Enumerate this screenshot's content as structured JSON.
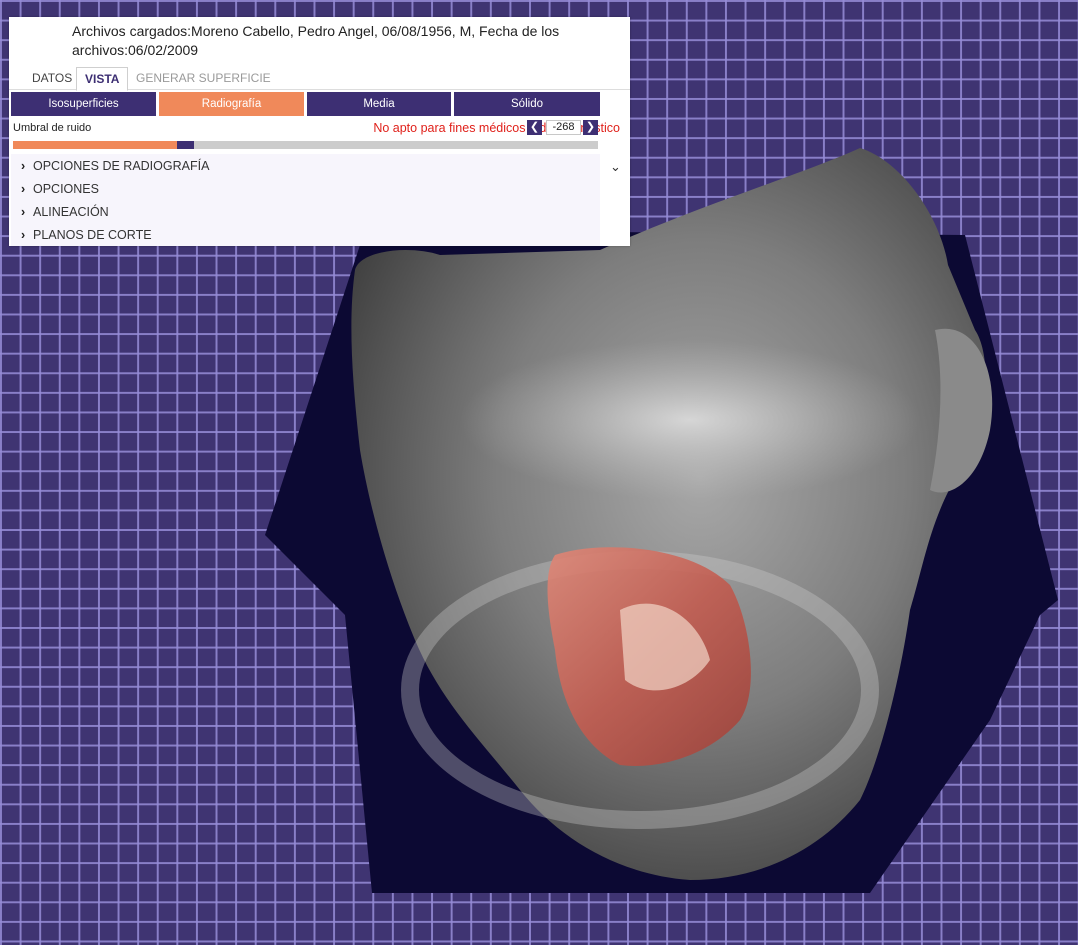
{
  "header": {
    "file_info": "Archivos cargados:Moreno Cabello, Pedro Angel, 06/08/1956, M, Fecha de los archivos:06/02/2009",
    "warning": "No apto para fines médicos o de diagnóstico"
  },
  "tabs": [
    {
      "label": "DATOS",
      "state": "normal"
    },
    {
      "label": "VISTA",
      "state": "active"
    },
    {
      "label": "GENERAR SUPERFICIE",
      "state": "disabled"
    }
  ],
  "render_modes": {
    "isosuperficies": "Isosuperficies",
    "radiografia": "Radiografía",
    "media": "Media",
    "solido": "Sólido",
    "selected": "Radiografía"
  },
  "noise": {
    "label": "Umbral de ruido",
    "value": "-268",
    "slider_level_percent": 28
  },
  "sections": {
    "radiografia": "OPCIONES DE RADIOGRAFÍA",
    "opciones": "OPCIONES",
    "alineacion": "ALINEACIÓN",
    "planos": "PLANOS DE CORTE"
  },
  "colors": {
    "accent_orange": "#f0895a",
    "accent_purple": "#3d2f73",
    "grid_background": "#3f3472",
    "warning_red": "#e0211b"
  },
  "icons": {
    "stepper_decrement": "chevron-left-icon",
    "stepper_increment": "chevron-right-icon",
    "section_expand": "chevron-right-icon",
    "panel_collapse": "chevron-down-icon"
  }
}
